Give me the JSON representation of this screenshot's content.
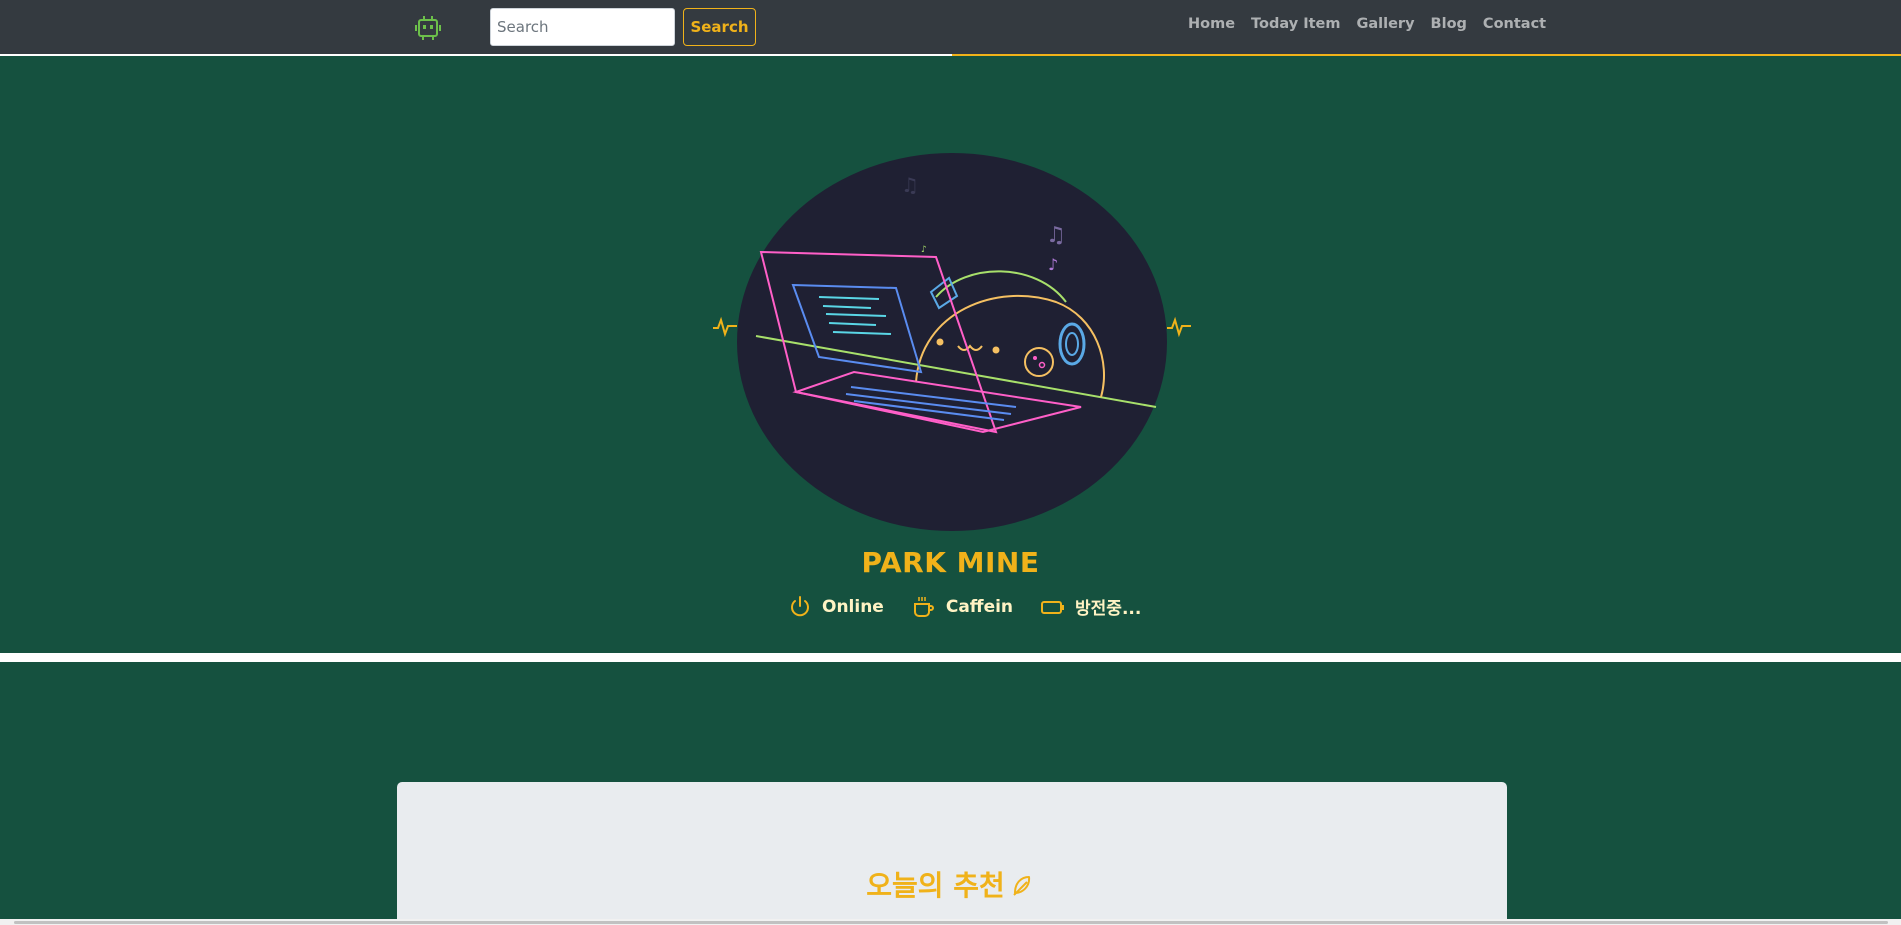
{
  "navbar": {
    "brand_icon": "pixel-robot-icon",
    "search": {
      "placeholder": "Search",
      "value": "",
      "button_label": "Search"
    },
    "links": [
      {
        "label": "Home"
      },
      {
        "label": "Today Item"
      },
      {
        "label": "Gallery"
      },
      {
        "label": "Blog"
      },
      {
        "label": "Contact"
      }
    ]
  },
  "hero": {
    "name": "PARK MINE",
    "status": [
      {
        "icon": "power-icon",
        "label": "Online"
      },
      {
        "icon": "coffee-cup-icon",
        "label": "Caffein"
      },
      {
        "icon": "battery-icon",
        "label": "방전중..."
      }
    ],
    "illustration": "cat-at-laptop-illustration"
  },
  "recommend": {
    "title": "오늘의 추천",
    "icon": "feather-icon"
  },
  "colors": {
    "navbar_bg": "#343a40",
    "page_bg": "#15513f",
    "accent": "#f0b21a",
    "card_bg": "#e9ecef",
    "avatar_bg": "#1f2033"
  }
}
